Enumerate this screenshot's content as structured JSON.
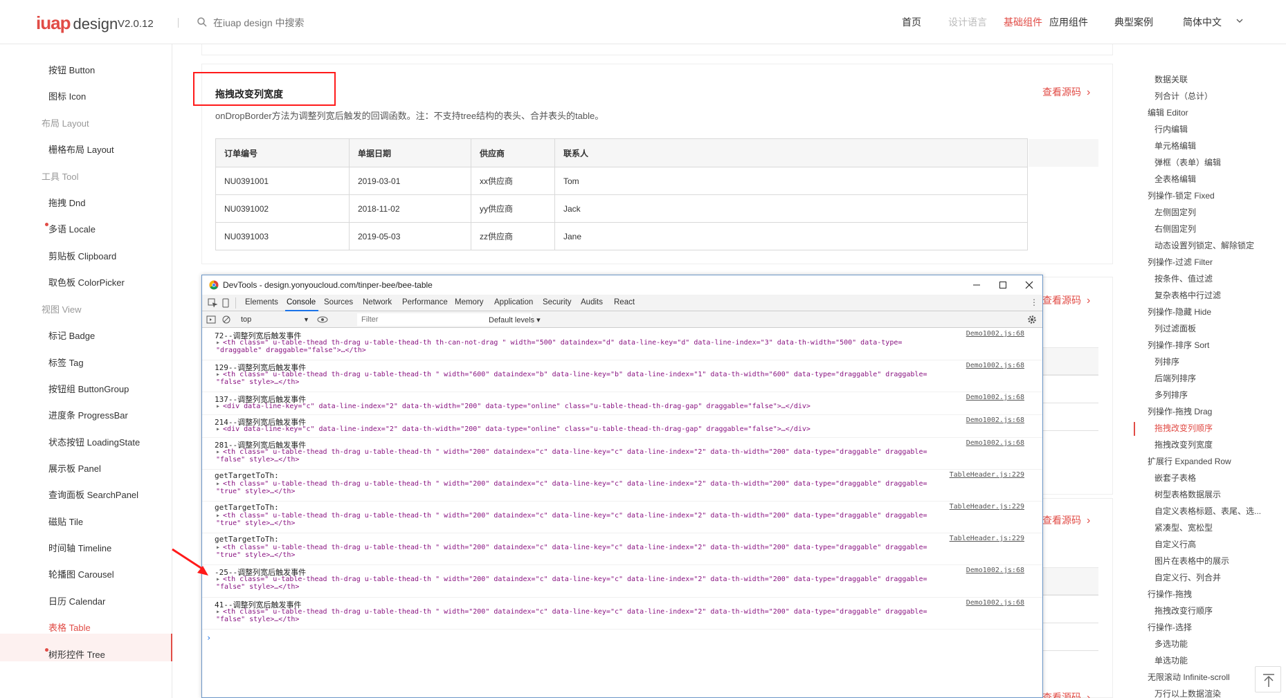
{
  "header": {
    "logo_mark": "iuap",
    "logo_word": "design",
    "version": "V2.0.12",
    "search_placeholder": "在iuap design 中搜索",
    "nav": [
      "首页",
      "设计语言",
      "基础组件",
      "应用组件",
      "典型案例",
      "简体中文"
    ]
  },
  "sidebar": {
    "items": [
      {
        "label": "按钮 Button",
        "type": "item"
      },
      {
        "label": "图标 Icon",
        "type": "item"
      },
      {
        "label": "布局 Layout",
        "type": "group"
      },
      {
        "label": "栅格布局 Layout",
        "type": "item"
      },
      {
        "label": "工具 Tool",
        "type": "group"
      },
      {
        "label": "拖拽 Dnd",
        "type": "item"
      },
      {
        "label": "多语 Locale",
        "type": "item",
        "dot": true
      },
      {
        "label": "剪贴板 Clipboard",
        "type": "item"
      },
      {
        "label": "取色板 ColorPicker",
        "type": "item"
      },
      {
        "label": "视图 View",
        "type": "group"
      },
      {
        "label": "标记 Badge",
        "type": "item"
      },
      {
        "label": "标签 Tag",
        "type": "item"
      },
      {
        "label": "按钮组 ButtonGroup",
        "type": "item"
      },
      {
        "label": "进度条 ProgressBar",
        "type": "item"
      },
      {
        "label": "状态按钮 LoadingState",
        "type": "item"
      },
      {
        "label": "展示板 Panel",
        "type": "item"
      },
      {
        "label": "查询面板 SearchPanel",
        "type": "item"
      },
      {
        "label": "磁贴 Tile",
        "type": "item"
      },
      {
        "label": "时间轴 Timeline",
        "type": "item"
      },
      {
        "label": "轮播图 Carousel",
        "type": "item"
      },
      {
        "label": "日历 Calendar",
        "type": "item"
      },
      {
        "label": "表格 Table",
        "type": "item",
        "active": true
      },
      {
        "label": "树形控件 Tree",
        "type": "item",
        "dot": true
      }
    ]
  },
  "demo": {
    "title": "拖拽改变列宽度",
    "description": "onDropBorder方法为调整列宽后触发的回调函数。注：不支持tree结构的表头、合并表头的table。",
    "view_source": "查看源码",
    "columns": [
      "订单编号",
      "单据日期",
      "供应商",
      "联系人"
    ],
    "rows": [
      [
        "NU0391001",
        "2019-03-01",
        "xx供应商",
        "Tom"
      ],
      [
        "NU0391002",
        "2018-11-02",
        "yy供应商",
        "Jack"
      ],
      [
        "NU0391003",
        "2019-05-03",
        "zz供应商",
        "Jane"
      ]
    ]
  },
  "anchors": [
    {
      "label": "数据关联",
      "level": 2
    },
    {
      "label": "列合计（总计）",
      "level": 2
    },
    {
      "label": "编辑 Editor",
      "level": 1
    },
    {
      "label": "行内编辑",
      "level": 2
    },
    {
      "label": "单元格编辑",
      "level": 2
    },
    {
      "label": "弹框（表单）编辑",
      "level": 2
    },
    {
      "label": "全表格编辑",
      "level": 2
    },
    {
      "label": "列操作-锁定 Fixed",
      "level": 1
    },
    {
      "label": "左侧固定列",
      "level": 2
    },
    {
      "label": "右侧固定列",
      "level": 2
    },
    {
      "label": "动态设置列锁定、解除锁定",
      "level": 2
    },
    {
      "label": "列操作-过滤 Filter",
      "level": 1
    },
    {
      "label": "按条件、值过滤",
      "level": 2
    },
    {
      "label": "复杂表格中行过滤",
      "level": 2
    },
    {
      "label": "列操作-隐藏 Hide",
      "level": 1
    },
    {
      "label": "列过滤面板",
      "level": 2
    },
    {
      "label": "列操作-排序 Sort",
      "level": 1
    },
    {
      "label": "列排序",
      "level": 2
    },
    {
      "label": "后端列排序",
      "level": 2
    },
    {
      "label": "多列排序",
      "level": 2
    },
    {
      "label": "列操作-拖拽 Drag",
      "level": 1
    },
    {
      "label": "拖拽改变列顺序",
      "level": 2,
      "active": true
    },
    {
      "label": "拖拽改变列宽度",
      "level": 2
    },
    {
      "label": "扩展行 Expanded Row",
      "level": 1
    },
    {
      "label": "嵌套子表格",
      "level": 2
    },
    {
      "label": "树型表格数据展示",
      "level": 2
    },
    {
      "label": "自定义表格标题、表尾、选...",
      "level": 2
    },
    {
      "label": "紧凑型、宽松型",
      "level": 2
    },
    {
      "label": "自定义行高",
      "level": 2
    },
    {
      "label": "图片在表格中的展示",
      "level": 2
    },
    {
      "label": "自定义行、列合并",
      "level": 2
    },
    {
      "label": "行操作-拖拽",
      "level": 1
    },
    {
      "label": "拖拽改变行顺序",
      "level": 2
    },
    {
      "label": "行操作-选择",
      "level": 1
    },
    {
      "label": "多选功能",
      "level": 2
    },
    {
      "label": "单选功能",
      "level": 2
    },
    {
      "label": "无限滚动 Infinite-scroll",
      "level": 1
    },
    {
      "label": "万行以上数据渲染",
      "level": 2
    }
  ],
  "devtools": {
    "title": "DevTools - design.yonyoucloud.com/tinper-bee/bee-table",
    "tabs": [
      "Elements",
      "Console",
      "Sources",
      "Network",
      "Performance",
      "Memory",
      "Application",
      "Security",
      "Audits",
      "React"
    ],
    "active_tab": "Console",
    "context": "top",
    "filter_placeholder": "Filter",
    "levels": "Default levels ▾",
    "logs": [
      {
        "head": "72--调整列宽后触发事件",
        "src": "Demo1002.js:68",
        "l2": "<th class=\" u-table-thead th-drag   u-table-thead-th th-can-not-drag \" width=\"500\" dataindex=\"d\" data-line-key=\"d\" data-line-index=\"3\" data-th-width=\"500\" data-type=",
        "l3": "\"draggable\" draggable=\"false\">…</th>"
      },
      {
        "head": "129--调整列宽后触发事件",
        "src": "Demo1002.js:68",
        "l2": "<th class=\" u-table-thead th-drag   u-table-thead-th  \" width=\"600\" dataindex=\"b\" data-line-key=\"b\" data-line-index=\"1\" data-th-width=\"600\" data-type=\"draggable\" draggable=",
        "l3": "\"false\" style>…</th>"
      },
      {
        "head": "137--调整列宽后触发事件",
        "src": "Demo1002.js:68",
        "l2": "<div data-line-key=\"c\" data-line-index=\"2\" data-th-width=\"200\" data-type=\"online\" class=\"u-table-thead-th-drag-gap\" draggable=\"false\">…</div>",
        "l3": ""
      },
      {
        "head": "214--调整列宽后触发事件",
        "src": "Demo1002.js:68",
        "l2": "<div data-line-key=\"c\" data-line-index=\"2\" data-th-width=\"200\" data-type=\"online\" class=\"u-table-thead-th-drag-gap\" draggable=\"false\">…</div>",
        "l3": ""
      },
      {
        "head": "281--调整列宽后触发事件",
        "src": "Demo1002.js:68",
        "l2": "<th class=\" u-table-thead th-drag   u-table-thead-th  \" width=\"200\" dataindex=\"c\" data-line-key=\"c\" data-line-index=\"2\" data-th-width=\"200\" data-type=\"draggable\" draggable=",
        "l3": "\"false\" style>…</th>"
      },
      {
        "head": " getTargetToTh:",
        "src": "TableHeader.js:229",
        "l2": "<th class=\" u-table-thead th-drag   u-table-thead-th  \" width=\"200\" dataindex=\"c\" data-line-key=\"c\" data-line-index=\"2\" data-th-width=\"200\" data-type=\"draggable\" draggable=",
        "l3": "\"true\" style>…</th>"
      },
      {
        "head": " getTargetToTh:",
        "src": "TableHeader.js:229",
        "l2": "<th class=\" u-table-thead th-drag   u-table-thead-th  \" width=\"200\" dataindex=\"c\" data-line-key=\"c\" data-line-index=\"2\" data-th-width=\"200\" data-type=\"draggable\" draggable=",
        "l3": "\"true\" style>…</th>"
      },
      {
        "head": " getTargetToTh:",
        "src": "TableHeader.js:229",
        "l2": "<th class=\" u-table-thead th-drag   u-table-thead-th  \" width=\"200\" dataindex=\"c\" data-line-key=\"c\" data-line-index=\"2\" data-th-width=\"200\" data-type=\"draggable\" draggable=",
        "l3": "\"true\" style>…</th>"
      },
      {
        "head": "-25--调整列宽后触发事件",
        "src": "Demo1002.js:68",
        "l2": "<th class=\" u-table-thead th-drag   u-table-thead-th  \" width=\"200\" dataindex=\"c\" data-line-key=\"c\" data-line-index=\"2\" data-th-width=\"200\" data-type=\"draggable\" draggable=",
        "l3": "\"false\" style>…</th>"
      },
      {
        "head": "41--调整列宽后触发事件",
        "src": "Demo1002.js:68",
        "l2": "<th class=\" u-table-thead th-drag   u-table-thead-th  \" width=\"200\" dataindex=\"c\" data-line-key=\"c\" data-line-index=\"2\" data-th-width=\"200\" data-type=\"draggable\" draggable=",
        "l3": "\"false\" style>…</th>"
      }
    ]
  },
  "colors": {
    "accent": "#e14c46",
    "annotation": "#ff1a1a",
    "devtools_blue": "#1a73e8"
  }
}
